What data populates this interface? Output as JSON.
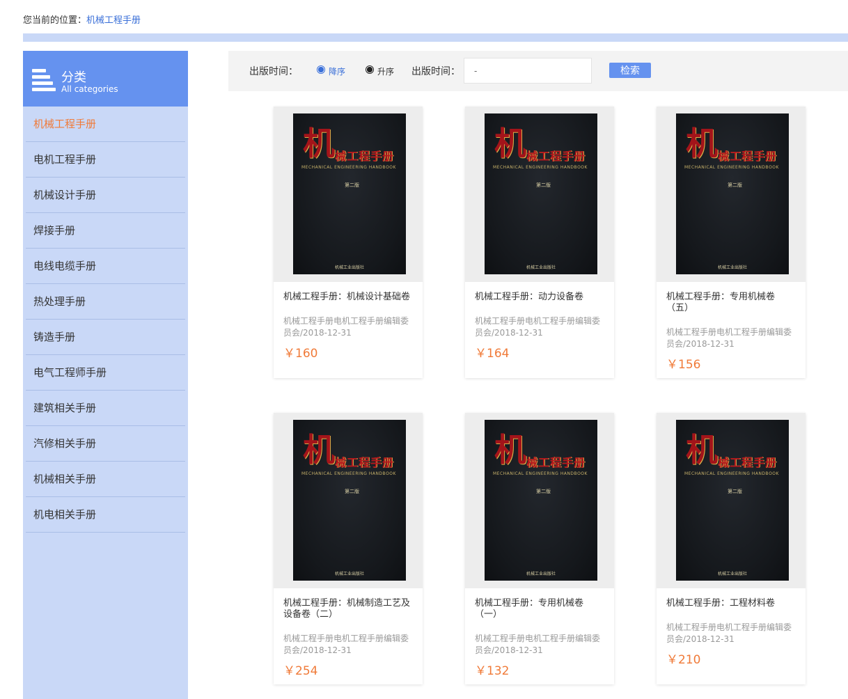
{
  "breadcrumb": {
    "prefix": "您当前的位置：",
    "current": "机械工程手册"
  },
  "sidebar": {
    "title": "分类",
    "subtitle": "All categories",
    "items": [
      {
        "label": "机械工程手册",
        "active": true
      },
      {
        "label": "电机工程手册"
      },
      {
        "label": "机械设计手册"
      },
      {
        "label": "焊接手册"
      },
      {
        "label": "电线电缆手册"
      },
      {
        "label": "热处理手册"
      },
      {
        "label": "铸造手册"
      },
      {
        "label": "电气工程师手册"
      },
      {
        "label": "建筑相关手册"
      },
      {
        "label": "汽修相关手册"
      },
      {
        "label": "机械相关手册"
      },
      {
        "label": "机电相关手册"
      }
    ]
  },
  "filter": {
    "label1": "出版时间：",
    "desc_label": "降序",
    "asc_label": "升序",
    "label2": "出版时间：",
    "input_value": "-",
    "search_label": "检索"
  },
  "cover": {
    "big_char": "机",
    "title": "械工程手册",
    "english": "MECHANICAL ENGINEERING HANDBOOK",
    "edition": "第二版",
    "publisher": "机械工业出版社"
  },
  "books": [
    {
      "title": "机械工程手册：机械设计基础卷",
      "meta": "机械工程手册电机工程手册编辑委员会/2018-12-31",
      "price": "￥160"
    },
    {
      "title": "机械工程手册：动力设备卷",
      "meta": "机械工程手册电机工程手册编辑委员会/2018-12-31",
      "price": "￥164"
    },
    {
      "title": "机械工程手册：专用机械卷（五）",
      "meta": "机械工程手册电机工程手册编辑委员会/2018-12-31",
      "price": "￥156"
    },
    {
      "title": "机械工程手册：机械制造工艺及设备卷（二）",
      "meta": "机械工程手册电机工程手册编辑委员会/2018-12-31",
      "price": "￥254"
    },
    {
      "title": "机械工程手册：专用机械卷（一）",
      "meta": "机械工程手册电机工程手册编辑委员会/2018-12-31",
      "price": "￥132"
    },
    {
      "title": "机械工程手册：工程材料卷",
      "meta": "机械工程手册电机工程手册编辑委员会/2018-12-31",
      "price": "￥210"
    }
  ],
  "colors": {
    "accent": "#6592ef",
    "sidebar_bg": "#c9d8f7",
    "active": "#f07a38",
    "price": "#f07a38"
  }
}
